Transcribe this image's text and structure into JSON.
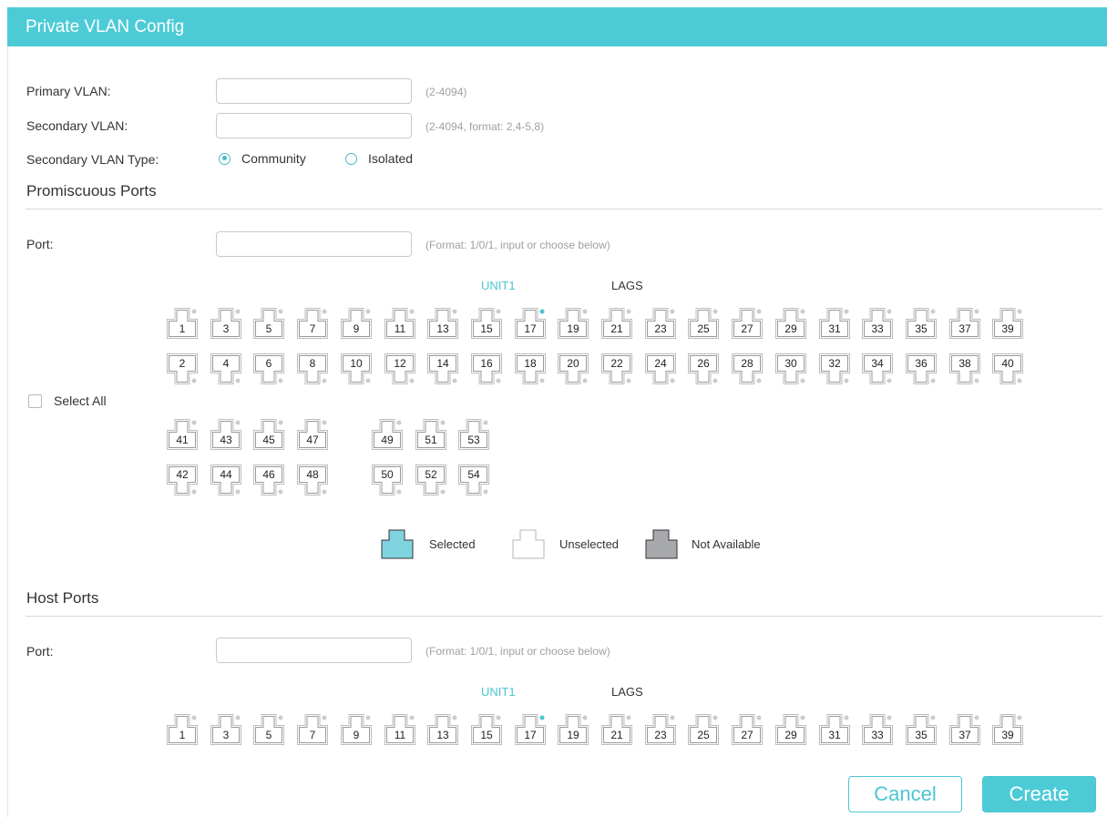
{
  "header": {
    "title": "Private VLAN Config"
  },
  "form": {
    "primary_vlan": {
      "label": "Primary VLAN:",
      "value": "",
      "hint": "(2-4094)"
    },
    "secondary_vlan": {
      "label": "Secondary VLAN:",
      "value": "",
      "hint": "(2-4094, format: 2,4-5,8)"
    },
    "secondary_type": {
      "label": "Secondary VLAN Type:",
      "options": [
        "Community",
        "Isolated"
      ],
      "selected": "Community"
    }
  },
  "promiscuous": {
    "title": "Promiscuous Ports",
    "port_label": "Port:",
    "port_value": "",
    "port_hint": "(Format: 1/0/1, input or choose below)",
    "tabs": [
      "UNIT1",
      "LAGS"
    ],
    "active_tab": "UNIT1",
    "select_all_label": "Select All",
    "ports_row_odd": [
      "1",
      "3",
      "5",
      "7",
      "9",
      "11",
      "13",
      "15",
      "17",
      "19",
      "21",
      "23",
      "25",
      "27",
      "29",
      "31",
      "33",
      "35",
      "37",
      "39"
    ],
    "ports_row_even": [
      "2",
      "4",
      "6",
      "8",
      "10",
      "12",
      "14",
      "16",
      "18",
      "20",
      "22",
      "24",
      "26",
      "28",
      "30",
      "32",
      "34",
      "36",
      "38",
      "40"
    ],
    "ports_group2_odd": [
      "41",
      "43",
      "45",
      "47"
    ],
    "ports_group2_even": [
      "42",
      "44",
      "46",
      "48"
    ],
    "ports_group3_odd": [
      "49",
      "51",
      "53"
    ],
    "ports_group3_even": [
      "50",
      "52",
      "54"
    ],
    "highlighted_port": "17"
  },
  "legend": {
    "selected": "Selected",
    "unselected": "Unselected",
    "not_available": "Not Available"
  },
  "host": {
    "title": "Host Ports",
    "port_label": "Port:",
    "port_value": "",
    "port_hint": "(Format: 1/0/1, input or choose below)",
    "tabs": [
      "UNIT1",
      "LAGS"
    ],
    "active_tab": "UNIT1",
    "ports_row_odd": [
      "1",
      "3",
      "5",
      "7",
      "9",
      "11",
      "13",
      "15",
      "17",
      "19",
      "21",
      "23",
      "25",
      "27",
      "29",
      "31",
      "33",
      "35",
      "37",
      "39"
    ],
    "highlighted_port": "17"
  },
  "buttons": {
    "cancel": "Cancel",
    "create": "Create"
  },
  "colors": {
    "accent": "#4ccbd6",
    "selected_fill": "#7fd3df",
    "not_available_fill": "#a7a9ac",
    "port_indicator": "#4cc5d2",
    "port_indicator_off": "#cccccc"
  }
}
